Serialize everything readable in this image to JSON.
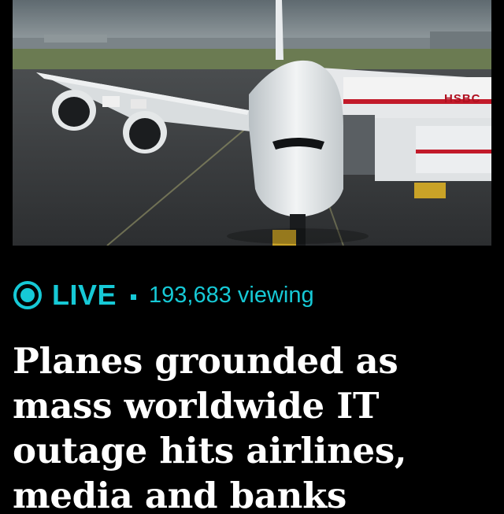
{
  "hero_image": {
    "description_icon": "airplane-photo",
    "sign_text": "HSBC"
  },
  "live": {
    "label": "LIVE",
    "viewers": "193,683 viewing",
    "icon": "live-indicator-icon",
    "accent_color": "#16c9d6"
  },
  "article": {
    "headline": "Planes grounded as mass worldwide IT outage hits airlines, media and banks"
  }
}
